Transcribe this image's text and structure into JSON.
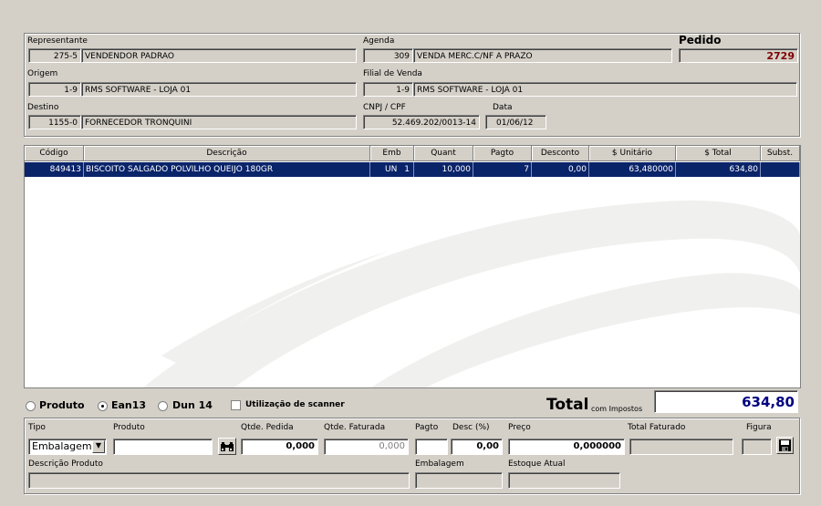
{
  "header": {
    "representante": {
      "label": "Representante",
      "code": "275-5",
      "name": "VENDENDOR PADRAO"
    },
    "agenda": {
      "label": "Agenda",
      "code": "309",
      "name": "VENDA MERC.C/NF A PRAZO"
    },
    "pedido": {
      "label": "Pedido",
      "value": "2729"
    },
    "origem": {
      "label": "Origem",
      "code": "1-9",
      "name": "RMS SOFTWARE - LOJA 01"
    },
    "filial": {
      "label": "Filial de Venda",
      "code": "1-9",
      "name": "RMS SOFTWARE - LOJA 01"
    },
    "destino": {
      "label": "Destino",
      "code": "1155-0",
      "name": "FORNECEDOR TRONQUINI"
    },
    "cnpj": {
      "label": "CNPJ / CPF",
      "value": "52.469.202/0013-14"
    },
    "data": {
      "label": "Data",
      "value": "01/06/12"
    }
  },
  "grid": {
    "columns": [
      "Código",
      "Descrição",
      "Emb",
      "Quant",
      "Pagto",
      "Desconto",
      "$ Unitário",
      "$ Total",
      "Subst."
    ],
    "rows": [
      {
        "codigo": "849413",
        "descricao": "BISCOITO SALGADO POLVILHO QUEIJO 180GR",
        "emb": "UN",
        "emb_qty": "1",
        "quant": "10,000",
        "pagto": "7",
        "desconto": "0,00",
        "unitario": "63,480000",
        "total": "634,80",
        "subst": ""
      }
    ]
  },
  "options": {
    "produto": "Produto",
    "ean13": "Ean13",
    "dun14": "Dun 14",
    "scanner": "Utilização de scanner",
    "selected": "ean13"
  },
  "total": {
    "label": "Total",
    "sub": "com Impostos",
    "value": "634,80"
  },
  "entry": {
    "tipo_label": "Tipo",
    "tipo_value": "Embalagem",
    "produto_label": "Produto",
    "produto_value": "",
    "qtde_pedida_label": "Qtde. Pedida",
    "qtde_pedida_value": "0,000",
    "qtde_faturada_label": "Qtde. Faturada",
    "qtde_faturada_value": "0,000",
    "pagto_label": "Pagto",
    "pagto_value": "",
    "desc_label": "Desc (%)",
    "desc_value": "0,00",
    "preco_label": "Preço",
    "preco_value": "0,000000",
    "total_faturado_label": "Total Faturado",
    "total_faturado_value": "",
    "figura_label": "Figura",
    "descricao_label": "Descrição Produto",
    "embalagem_label": "Embalagem",
    "estoque_label": "Estoque Atual"
  },
  "colors": {
    "selection": "#0a246a",
    "pedido_value": "#800000",
    "total_value": "#000080"
  }
}
